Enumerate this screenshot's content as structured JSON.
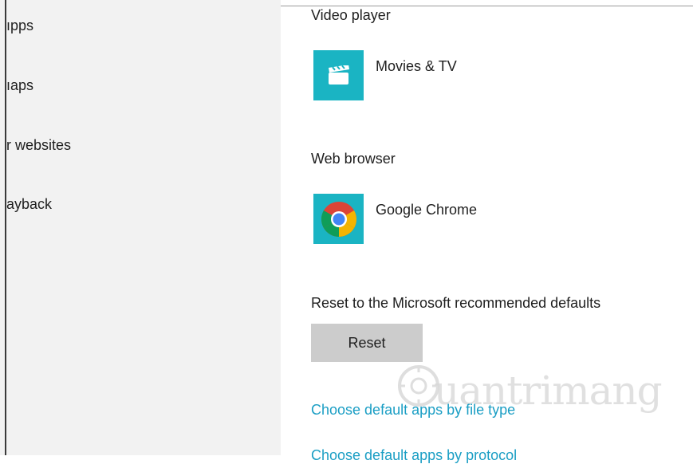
{
  "sidebar": {
    "items": [
      {
        "label": "ıpps"
      },
      {
        "label": "ıaps"
      },
      {
        "label": "r websites"
      },
      {
        "label": "ayback"
      }
    ]
  },
  "sections": {
    "video_player": {
      "label": "Video player",
      "app_name": "Movies & TV",
      "icon": "movies-tv-icon"
    },
    "web_browser": {
      "label": "Web browser",
      "app_name": "Google Chrome",
      "icon": "chrome-icon"
    },
    "reset": {
      "label": "Reset to the Microsoft recommended defaults",
      "button_label": "Reset"
    }
  },
  "links": {
    "by_file_type": "Choose default apps by file type",
    "by_protocol": "Choose default apps by protocol"
  },
  "watermark": {
    "text": "uantrimang"
  },
  "colors": {
    "accent": "#1a9ec4",
    "tile": "#1ab4c3",
    "sidebar_bg": "#f2f2f2",
    "button_bg": "#cccccc"
  }
}
